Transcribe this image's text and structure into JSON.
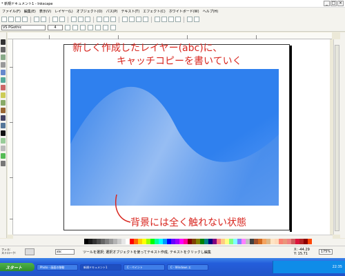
{
  "window": {
    "title": "* 新規ドキュメント1 - Inkscape"
  },
  "menubar": [
    "ファイル(F)",
    "編集(E)",
    "表示(V)",
    "レイヤー(L)",
    "オブジェクト(O)",
    "パス(P)",
    "テキスト(T)",
    "エフェクト(C)",
    "ホワイトボード(W)",
    "ヘルプ(H)"
  ],
  "text_toolbar": {
    "font": "VS PGothic",
    "size": "4"
  },
  "annotations": {
    "top_line1": "新しく作成したレイヤー(abc)に、",
    "top_line2": "キャッチコピーを書いていく",
    "bottom": "背景には全く触れない状態"
  },
  "background": {
    "gradient_colors": [
      "#2f80ee",
      "#5c9cf5",
      "#e9f2ff"
    ]
  },
  "status": {
    "fill_label": "フィル:",
    "stroke_label": "ストローク:",
    "layer": "abc",
    "message": "ツールを選択; 選択オブジェクトを使ってテキスト作成, テキストをクリックし編集",
    "coords_x": "X: -44.29",
    "coords_y": "Y: 15.71",
    "zoom": "175%"
  },
  "taskbar": {
    "start": "スタート",
    "tasks": [
      "Photo - 画面の移動",
      "新規ドキュメント1",
      "C - ペイント",
      "C - Windows エ"
    ],
    "clock": "22:35"
  },
  "palette": [
    "#000000",
    "#1a1a1a",
    "#333333",
    "#4d4d4d",
    "#666666",
    "#808080",
    "#999999",
    "#b3b3b3",
    "#cccccc",
    "#e6e6e6",
    "#ffffff",
    "#ff0000",
    "#ff6600",
    "#ffcc00",
    "#ffff00",
    "#99ff00",
    "#00ff00",
    "#00ff99",
    "#00ffff",
    "#0099ff",
    "#0000ff",
    "#6600ff",
    "#9900ff",
    "#ff00ff",
    "#ff0099",
    "#800000",
    "#804000",
    "#808000",
    "#008000",
    "#008080",
    "#000080",
    "#800080",
    "#ff8080",
    "#ffcc80",
    "#ffff80",
    "#80ff80",
    "#80ffff",
    "#8080ff",
    "#ff80ff",
    "#c0c0c0",
    "#404040",
    "#a0522d",
    "#d2691e",
    "#f4a460",
    "#deb887",
    "#ffe4c4",
    "#ffdab9",
    "#fa8072",
    "#e9967a",
    "#f08080",
    "#cd5c5c",
    "#dc143c",
    "#b22222",
    "#8b0000",
    "#ff4500"
  ]
}
